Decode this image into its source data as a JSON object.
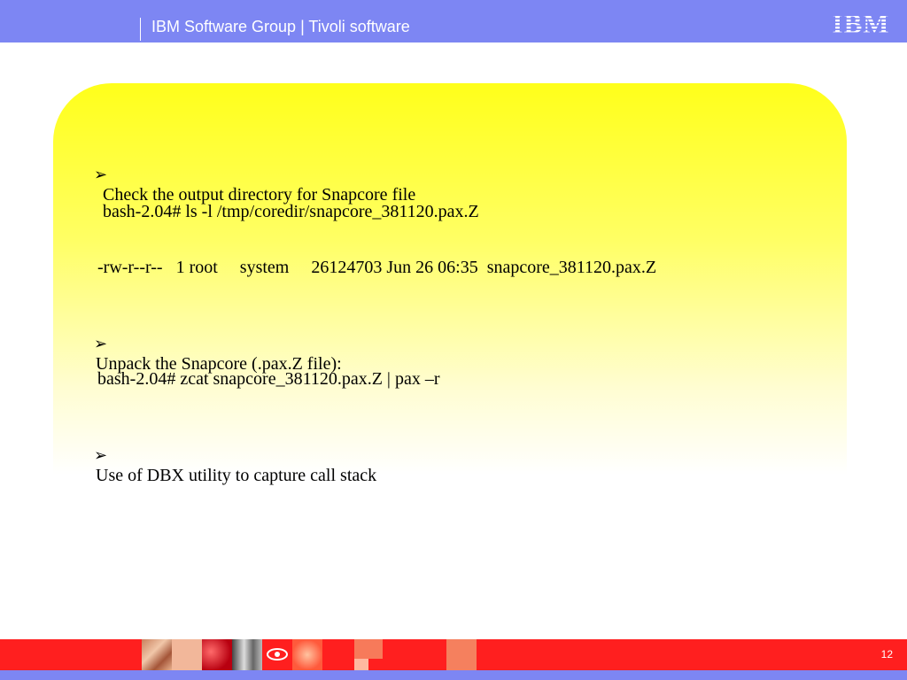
{
  "header": {
    "title": "IBM Software Group | Tivoli software",
    "logo_text": "IBM"
  },
  "content": {
    "line1": "Check the output directory for Snapcore file",
    "line2": "bash-2.04# ls -l /tmp/coredir/snapcore_381120.pax.Z",
    "line3": "-rw-r--r--   1 root     system     26124703 Jun 26 06:35  snapcore_381120.pax.Z",
    "line4": "Unpack the Snapcore (.pax.Z file):",
    "line5": "bash-2.04# zcat snapcore_381120.pax.Z | pax –r",
    "line6": "Use of DBX utility to capture call stack"
  },
  "bullets": {
    "arrow": "➢"
  },
  "footer": {
    "page_number": "12"
  },
  "colors": {
    "header_bar": "#7d86f3",
    "footer_red": "#ff1f1f",
    "panel_top": "#ffff1a"
  }
}
